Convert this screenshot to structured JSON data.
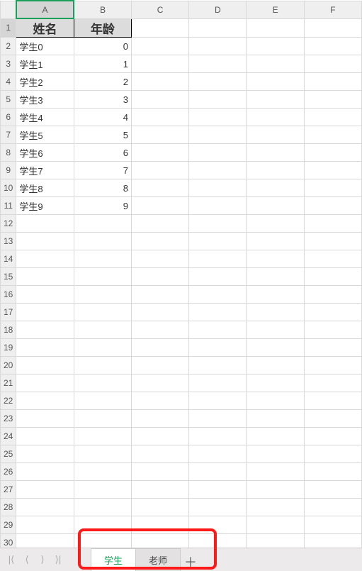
{
  "columns": [
    "A",
    "B",
    "C",
    "D",
    "E",
    "F"
  ],
  "row_count": 30,
  "header_row": {
    "A": "姓名",
    "B": "年龄"
  },
  "data_rows": [
    {
      "A": "学生0",
      "B": "0"
    },
    {
      "A": "学生1",
      "B": "1"
    },
    {
      "A": "学生2",
      "B": "2"
    },
    {
      "A": "学生3",
      "B": "3"
    },
    {
      "A": "学生4",
      "B": "4"
    },
    {
      "A": "学生5",
      "B": "5"
    },
    {
      "A": "学生6",
      "B": "6"
    },
    {
      "A": "学生7",
      "B": "7"
    },
    {
      "A": "学生8",
      "B": "8"
    },
    {
      "A": "学生9",
      "B": "9"
    }
  ],
  "selected_column": "A",
  "tabs": {
    "active": "学生",
    "items": [
      "学生",
      "老师"
    ]
  },
  "nav_icons": {
    "first": "|⟨",
    "prev": "⟨",
    "next": "⟩",
    "last": "⟩|"
  },
  "add_tab": "＋"
}
